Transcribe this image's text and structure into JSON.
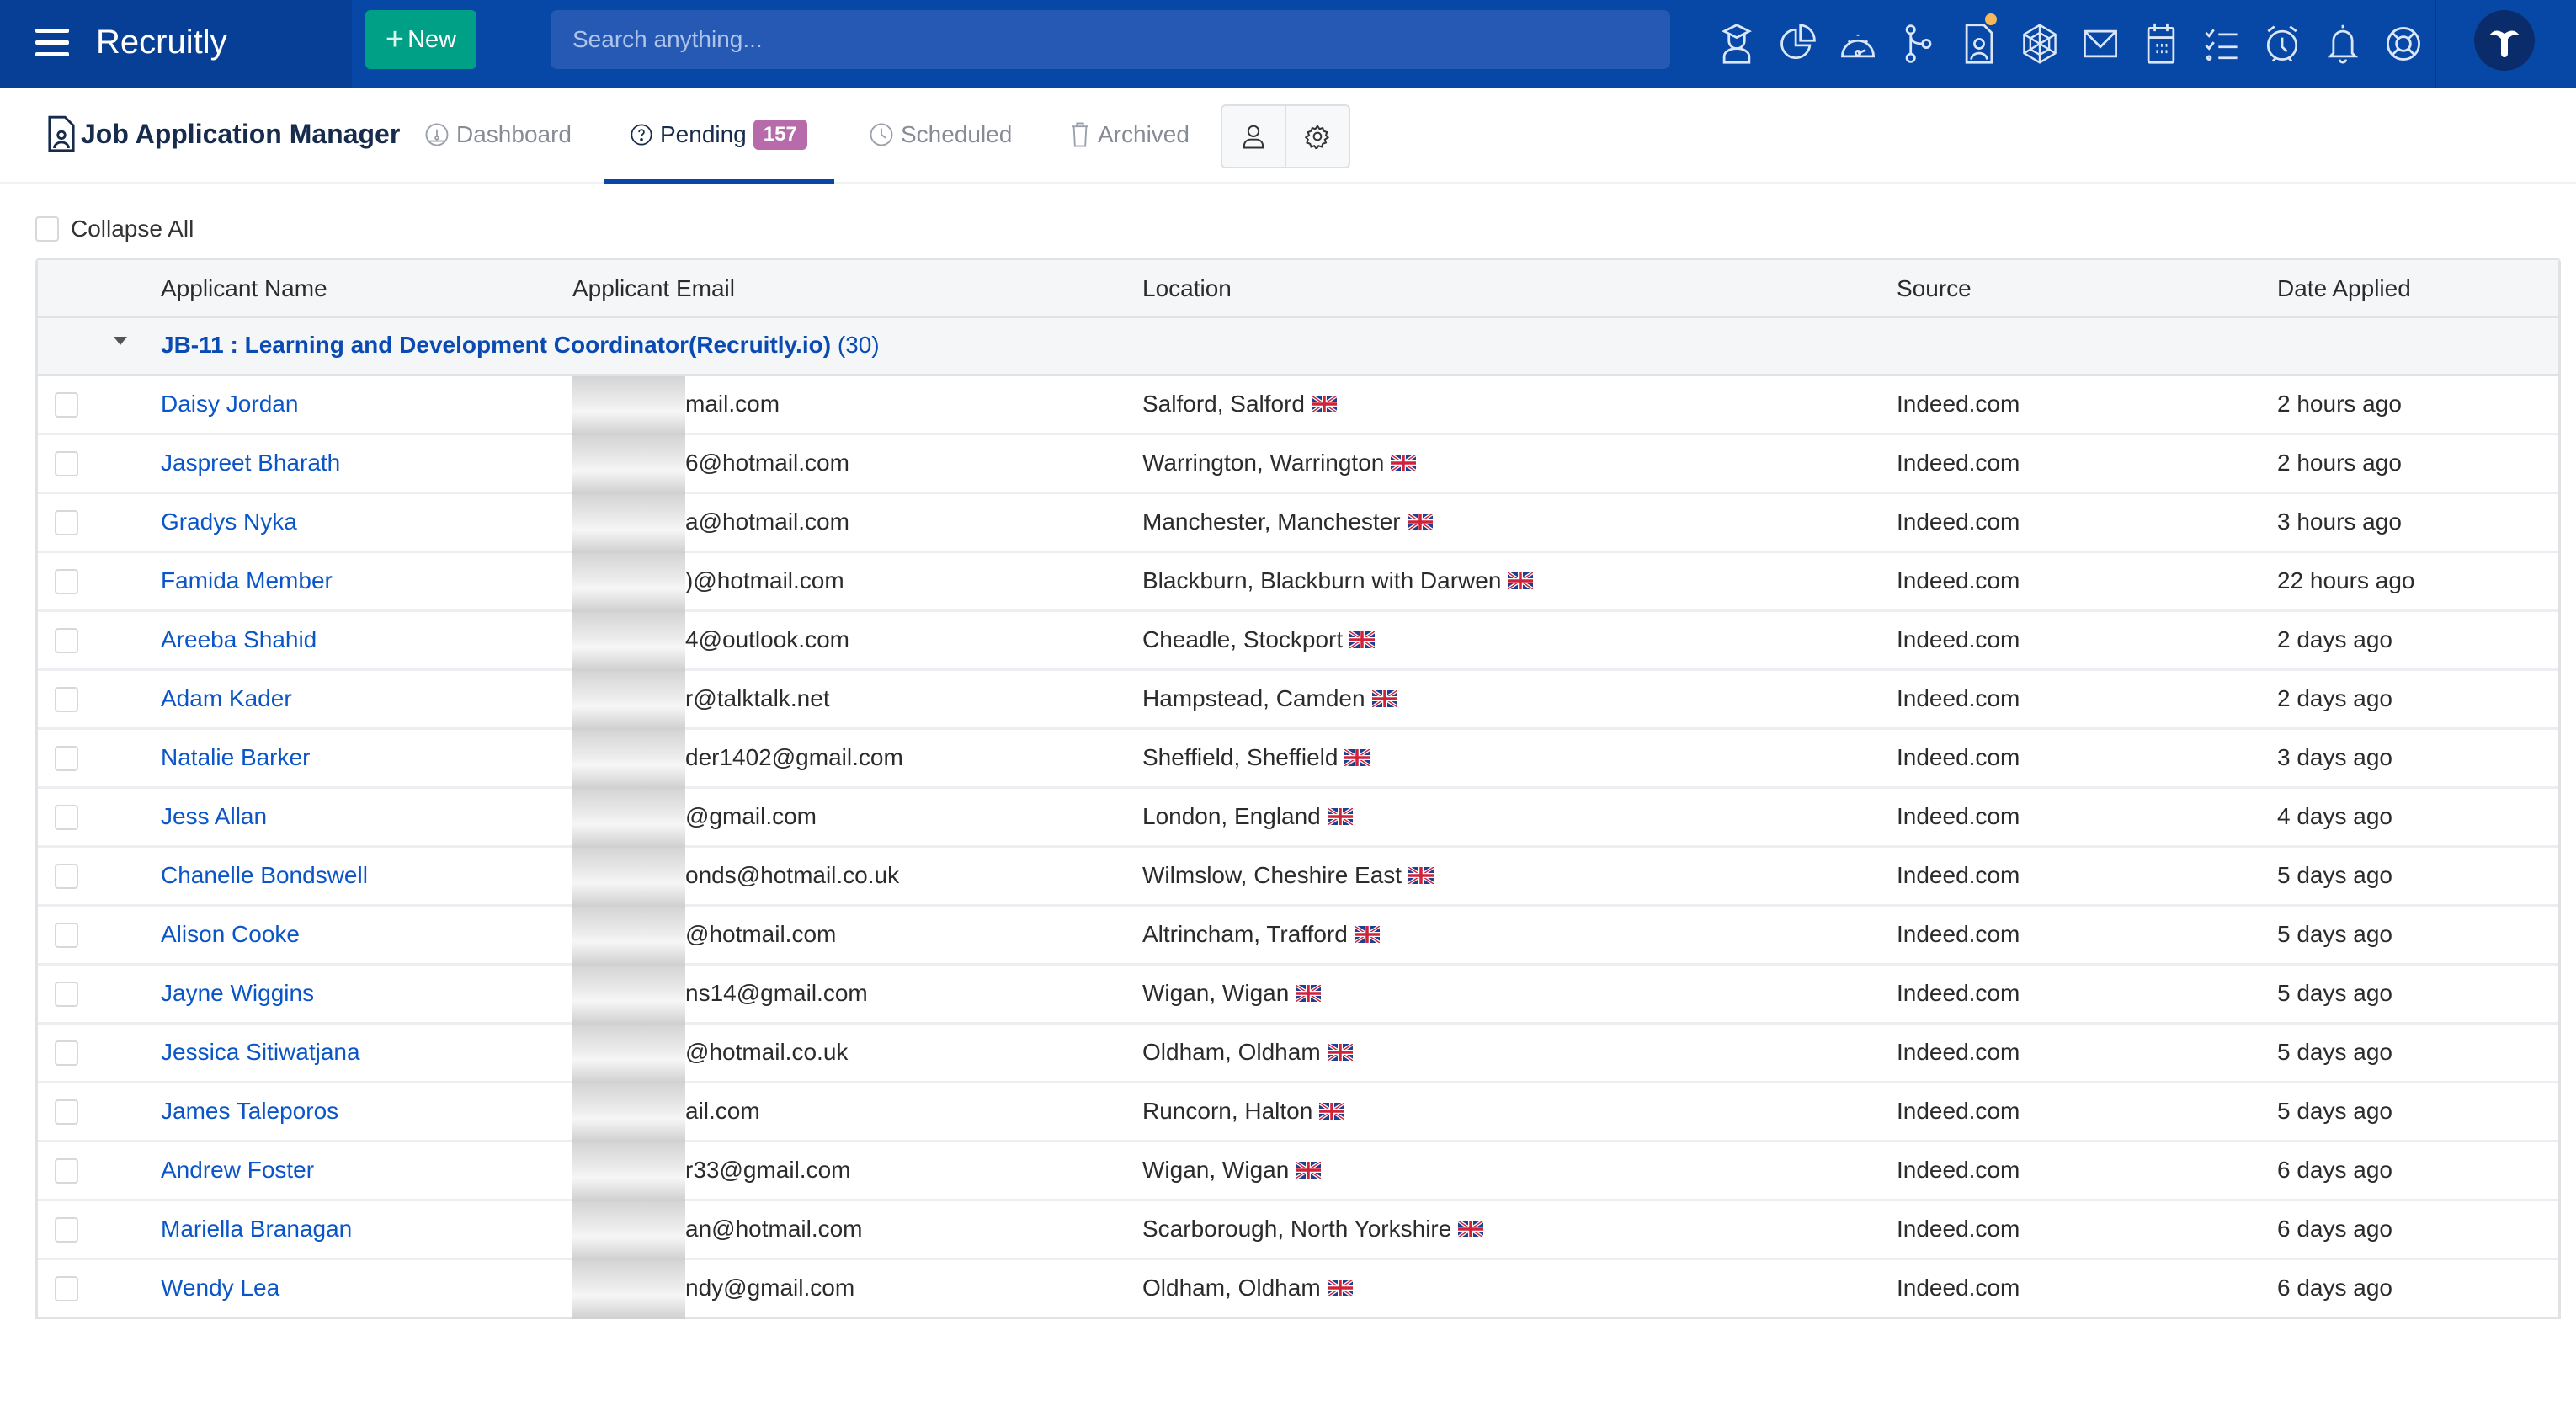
{
  "topbar": {
    "brand": "Recruitly",
    "new_label": "New",
    "search_placeholder": "Search anything...",
    "icons": [
      "graduate-icon",
      "pie-chart-icon",
      "gauge-icon",
      "pipeline-icon",
      "candidate-file-icon",
      "web-icon",
      "mail-icon",
      "calendar-icon",
      "checklist-icon",
      "alarm-clock-icon",
      "bell-icon",
      "lifebuoy-icon"
    ],
    "notification_dot_on": "candidate-file-icon"
  },
  "subheader": {
    "app_title": "Job Application Manager",
    "tabs": [
      {
        "label": "Dashboard",
        "icon": "dashboard-icon",
        "active": false
      },
      {
        "label": "Pending",
        "icon": "question-circle-icon",
        "active": true,
        "badge": "157"
      },
      {
        "label": "Scheduled",
        "icon": "clock-icon",
        "active": false
      },
      {
        "label": "Archived",
        "icon": "trash-icon",
        "active": false
      }
    ]
  },
  "collapse_all_label": "Collapse All",
  "table": {
    "columns": [
      "Applicant Name",
      "Applicant Email",
      "Location",
      "Source",
      "Date Applied"
    ],
    "group": {
      "title": "JB-11 : Learning and Development Coordinator(Recruitly.io)",
      "count": "(30)"
    },
    "rows": [
      {
        "name": "Daisy Jordan",
        "email": "mail.com",
        "location": "Salford, Salford",
        "source": "Indeed.com",
        "date": "2 hours ago"
      },
      {
        "name": "Jaspreet Bharath",
        "email": "6@hotmail.com",
        "location": "Warrington, Warrington",
        "source": "Indeed.com",
        "date": "2 hours ago"
      },
      {
        "name": "Gradys Nyka",
        "email": "a@hotmail.com",
        "location": "Manchester, Manchester",
        "source": "Indeed.com",
        "date": "3 hours ago"
      },
      {
        "name": "Famida Member",
        "email": ")@hotmail.com",
        "location": "Blackburn, Blackburn with Darwen",
        "source": "Indeed.com",
        "date": "22 hours ago"
      },
      {
        "name": "Areeba Shahid",
        "email": "4@outlook.com",
        "location": "Cheadle, Stockport",
        "source": "Indeed.com",
        "date": "2 days ago"
      },
      {
        "name": "Adam Kader",
        "email": "r@talktalk.net",
        "location": "Hampstead, Camden",
        "source": "Indeed.com",
        "date": "2 days ago"
      },
      {
        "name": "Natalie Barker",
        "email": "der1402@gmail.com",
        "location": "Sheffield, Sheffield",
        "source": "Indeed.com",
        "date": "3 days ago"
      },
      {
        "name": "Jess Allan",
        "email": "@gmail.com",
        "location": "London, England",
        "source": "Indeed.com",
        "date": "4 days ago"
      },
      {
        "name": "Chanelle Bondswell",
        "email": "onds@hotmail.co.uk",
        "location": "Wilmslow, Cheshire East",
        "source": "Indeed.com",
        "date": "5 days ago"
      },
      {
        "name": "Alison Cooke",
        "email": "@hotmail.com",
        "location": "Altrincham, Trafford",
        "source": "Indeed.com",
        "date": "5 days ago"
      },
      {
        "name": "Jayne Wiggins",
        "email": "ns14@gmail.com",
        "location": "Wigan, Wigan",
        "source": "Indeed.com",
        "date": "5 days ago"
      },
      {
        "name": "Jessica Sitiwatjana",
        "email": "@hotmail.co.uk",
        "location": "Oldham, Oldham",
        "source": "Indeed.com",
        "date": "5 days ago"
      },
      {
        "name": "James Taleporos",
        "email": "ail.com",
        "location": "Runcorn, Halton",
        "source": "Indeed.com",
        "date": "5 days ago"
      },
      {
        "name": "Andrew Foster",
        "email": "r33@gmail.com",
        "location": "Wigan, Wigan",
        "source": "Indeed.com",
        "date": "6 days ago"
      },
      {
        "name": "Mariella Branagan",
        "email": "an@hotmail.com",
        "location": "Scarborough, North Yorkshire",
        "source": "Indeed.com",
        "date": "6 days ago"
      },
      {
        "name": "Wendy Lea",
        "email": "ndy@gmail.com",
        "location": "Oldham, Oldham",
        "source": "Indeed.com",
        "date": "6 days ago"
      }
    ]
  },
  "colors": {
    "topbar": "#0747a6",
    "new_button": "#00a087",
    "link": "#0a55c8",
    "badge": "#b86bab"
  }
}
